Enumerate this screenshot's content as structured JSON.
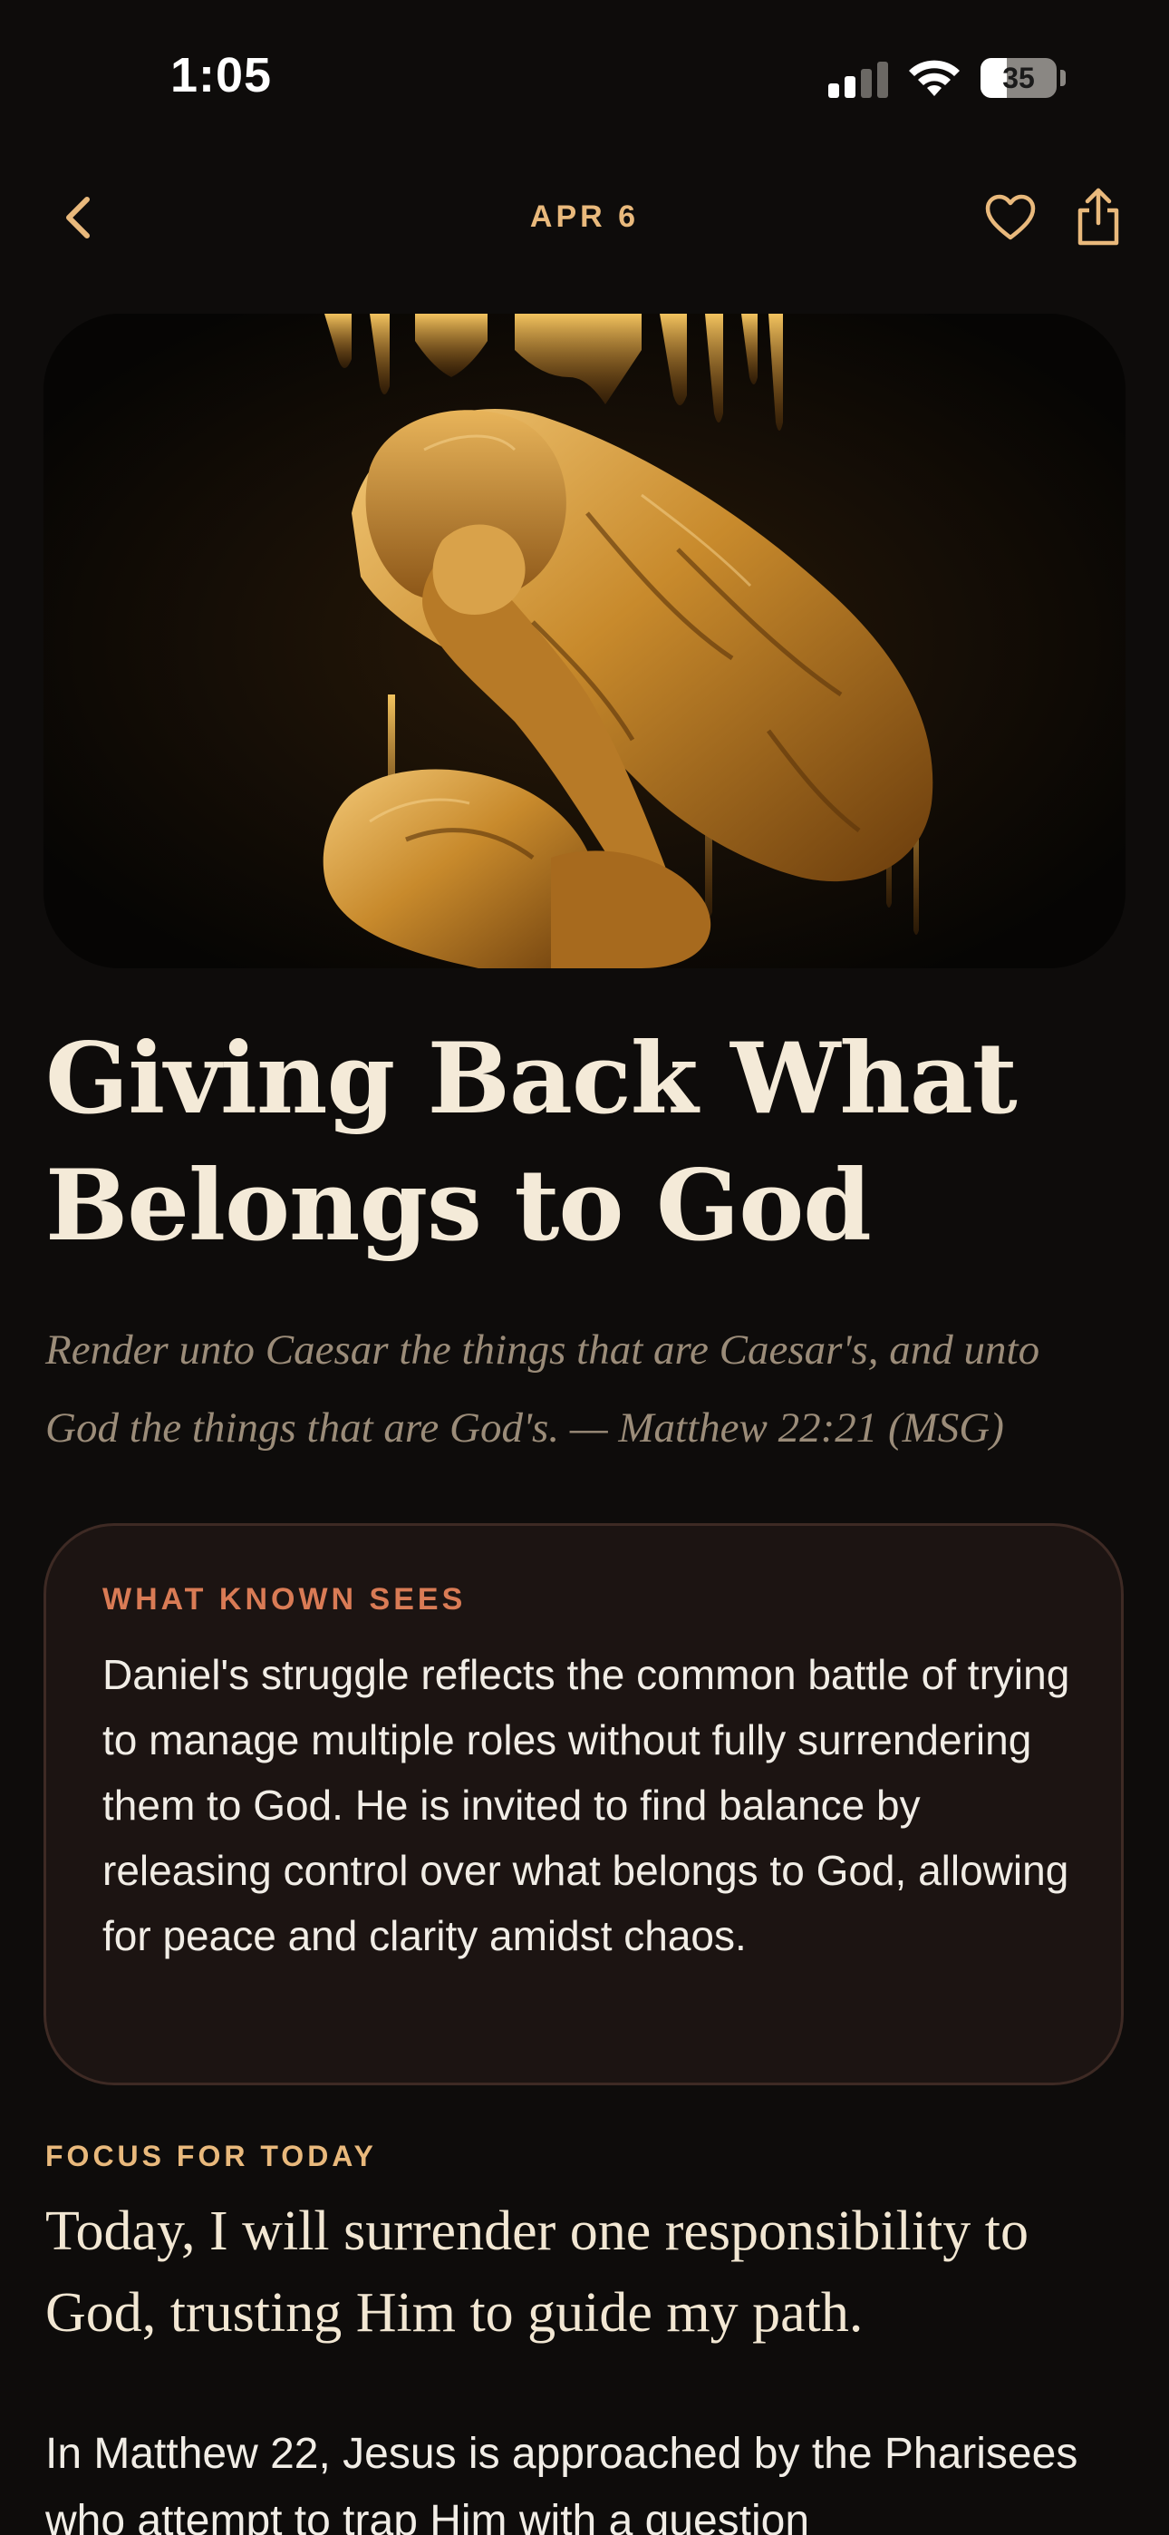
{
  "status_bar": {
    "time": "1:05",
    "battery_level": "35",
    "signal_bars_active": 2,
    "signal_bars_total": 4
  },
  "nav": {
    "date": "APR 6",
    "back_icon": "chevron-left-icon",
    "favorite_icon": "heart-icon",
    "share_icon": "share-icon"
  },
  "hero": {
    "image": "gold-painted-crouching-figure-artwork"
  },
  "devotional": {
    "title": "Giving Back What Belongs to God",
    "verse": "Render unto Caesar the things that are Caesar's, and unto God the things that are God's. — Matthew 22:21 (MSG)"
  },
  "insight_card": {
    "label": "WHAT KNOWN SEES",
    "body": "Daniel's struggle reflects the common battle of trying to manage multiple roles without fully surrendering them to God. He is invited to find balance by releasing control over what belongs to God, allowing for peace and clarity amidst chaos."
  },
  "focus": {
    "label": "FOCUS FOR TODAY",
    "text": "Today, I will surrender one responsibility to God, trusting Him to guide my path."
  },
  "body": {
    "text": "In Matthew 22, Jesus is approached by the Pharisees who attempt to trap Him with a question"
  },
  "colors": {
    "background": "#0e0c0b",
    "accent_gold": "#e9b97c",
    "accent_coral": "#d97b55",
    "card_background": "#1c1412",
    "card_border": "#3e2a24"
  }
}
